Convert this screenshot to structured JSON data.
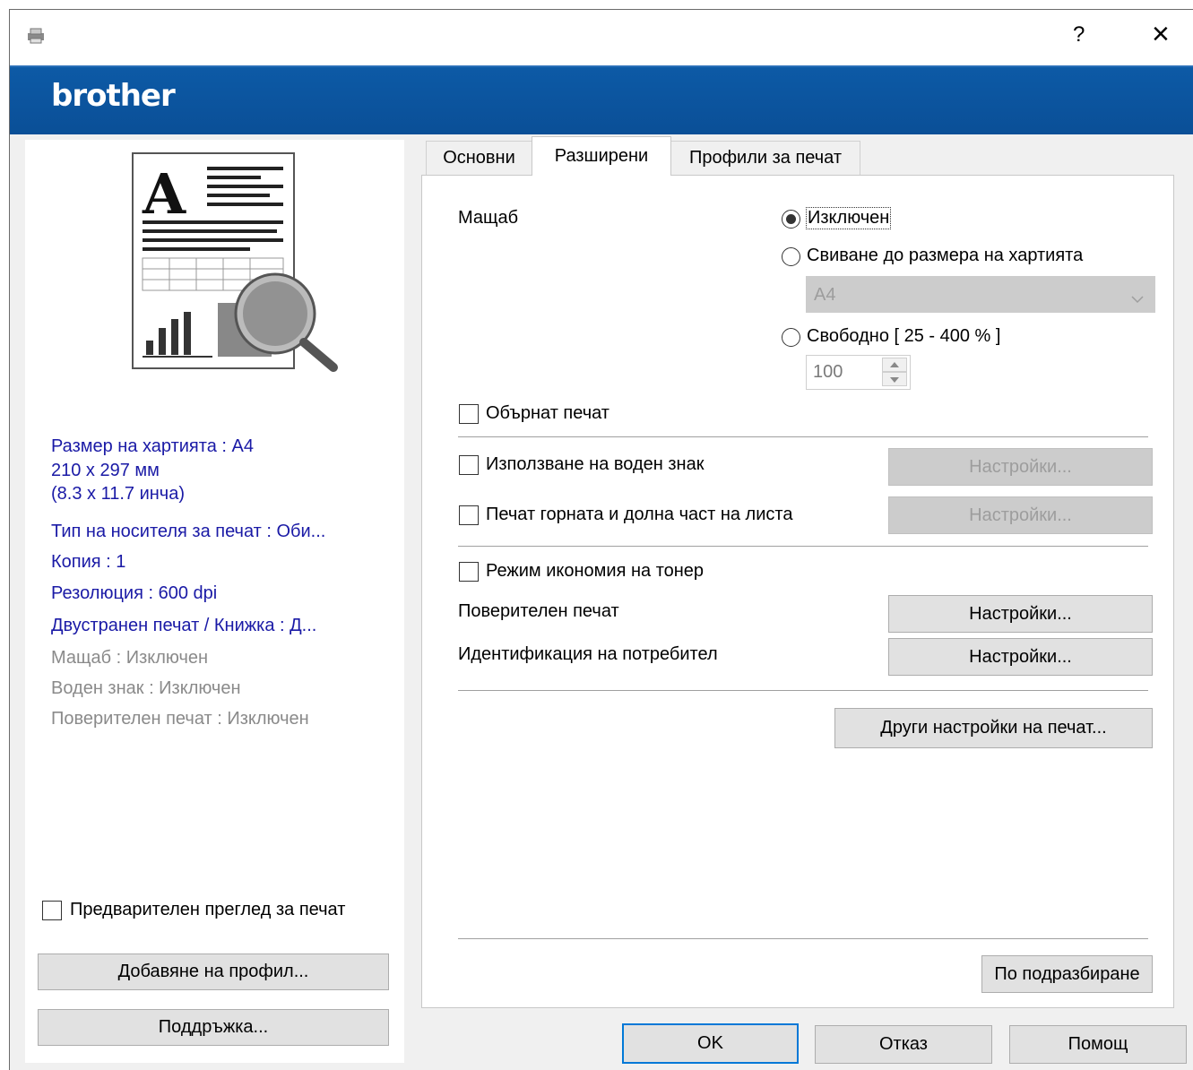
{
  "window": {
    "help_label": "?",
    "close_label": "×"
  },
  "brand": {
    "logo": "brother"
  },
  "tabs": [
    {
      "label": "Основни"
    },
    {
      "label": "Разширени"
    },
    {
      "label": "Профили за печат"
    }
  ],
  "preview": {
    "icon": "document-magnifier-illustration"
  },
  "summary": {
    "paper_size": "Размер на хартията : A4",
    "dims_mm": "210 x 297 мм",
    "dims_in": "(8.3 x 11.7 инча)",
    "media_type": "Тип на носителя за печат : Оби...",
    "copies": "Копия : 1",
    "resolution": "Резолюция : 600 dpi",
    "duplex": "Двустранен печат / Книжка : Д...",
    "scale": "Мащаб : Изключен",
    "watermark": "Воден знак : Изключен",
    "secure": "Поверителен печат : Изключен"
  },
  "left": {
    "print_preview": "Предварителен преглед за печат",
    "add_profile": "Добавяне на профил...",
    "support": "Поддръжка..."
  },
  "advanced": {
    "scaling_label": "Мащаб",
    "scaling_off": "Изключен",
    "scaling_fit": "Свиване до размера на хартията",
    "paper_select_value": "A4",
    "scaling_free": "Свободно [ 25 - 400 % ]",
    "free_value": "100",
    "reverse_print": "Обърнат печат",
    "use_watermark": "Използване на воден знак",
    "header_footer": "Печат горната и долна част на листа",
    "toner_save": "Режим икономия на тонер",
    "secure_print": "Поверителен печат",
    "user_auth": "Идентификация на потребител",
    "settings_btn": "Настройки...",
    "other_settings": "Други настройки на печат...",
    "defaults": "По подразбиране"
  },
  "footer": {
    "ok": "OK",
    "cancel": "Отказ",
    "help": "Помощ"
  },
  "colors": {
    "brand_blue": "#0b55a0",
    "summary_blue": "#1a1aa6",
    "disabled_grey": "#9d9d9d"
  }
}
